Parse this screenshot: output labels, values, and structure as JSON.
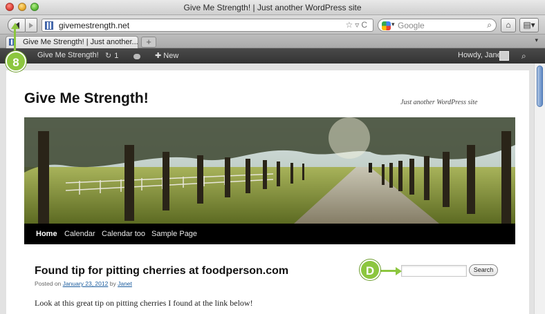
{
  "window": {
    "title": "Give Me Strength! | Just another WordPress site"
  },
  "toolbar": {
    "url": "givemestrength.net",
    "search_placeholder": "Google",
    "home_icon": "home-icon",
    "bookmarks_icon": "bookmarks-icon"
  },
  "tabs": [
    {
      "label": "Give Me Strength! | Just another...",
      "active": true
    }
  ],
  "admin_bar": {
    "site_name": "Give Me Strength!",
    "updates_count": "1",
    "new_label": "New",
    "greeting": "Howdy, Janet"
  },
  "site": {
    "title": "Give Me Strength!",
    "tagline": "Just another WordPress site"
  },
  "nav": {
    "items": [
      {
        "label": "Home",
        "active": true
      },
      {
        "label": "Calendar",
        "active": false
      },
      {
        "label": "Calendar too",
        "active": false
      },
      {
        "label": "Sample Page",
        "active": false
      }
    ]
  },
  "post": {
    "title": "Found tip for pitting cherries at foodperson.com",
    "meta_prefix": "Posted on",
    "date": "January 23, 2012",
    "meta_by": "by",
    "author": "Janet",
    "excerpt": "Look at this great tip on pitting cherries I found at the link below!"
  },
  "sidebar_search": {
    "button_label": "Search",
    "value": ""
  },
  "callouts": {
    "step_number": "8",
    "step_letter": "D"
  },
  "colors": {
    "callout_green": "#8cc63f",
    "admin_bar": "#333333",
    "nav_bar": "#000000",
    "link_blue": "#1b5c9e"
  }
}
